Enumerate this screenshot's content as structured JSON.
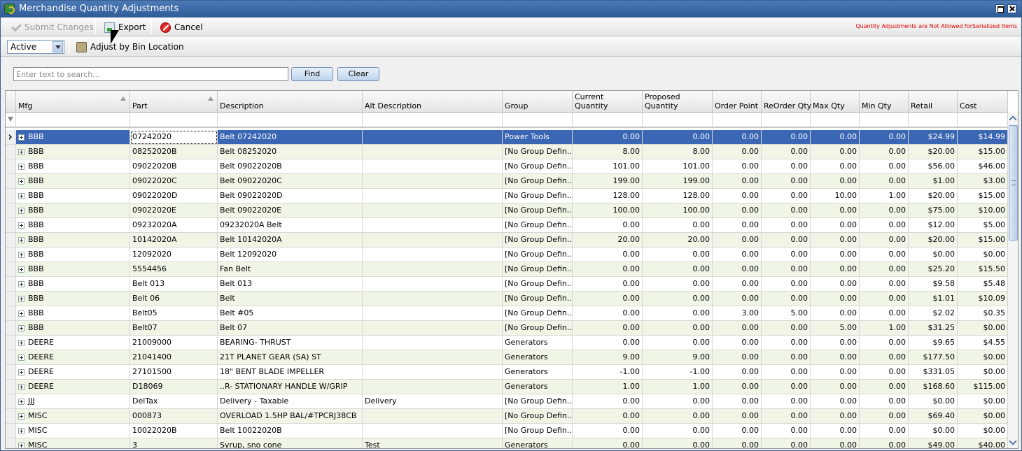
{
  "window": {
    "title": "Merchandise Quantity Adjustments"
  },
  "toolbar": {
    "submit_label": "Submit Changes",
    "export_label": "Export",
    "cancel_label": "Cancel",
    "warning": "Quantity Adjustments are Not Allowed forSerialized Items"
  },
  "filterbar": {
    "status_value": "Active",
    "adjust_bin_label": "Adjust by Bin Location"
  },
  "search": {
    "placeholder": "Enter text to search...",
    "find_label": "Find",
    "clear_label": "Clear"
  },
  "grid": {
    "headers": [
      "Mfg",
      "Part",
      "Description",
      "Alt Description",
      "Group",
      "Current\nQuantity",
      "Proposed\nQuantity",
      "Order Point",
      "ReOrder Qty",
      "Max Qty",
      "Min Qty",
      "Retail",
      "Cost"
    ],
    "rows": [
      [
        "BBB",
        "07242020",
        "Belt 07242020",
        "",
        "Power Tools",
        "0.00",
        "0.00",
        "0.00",
        "0.00",
        "0.00",
        "0.00",
        "$24.99",
        "$14.99"
      ],
      [
        "BBB",
        "08252020B",
        "Belt 08252020",
        "",
        "[No Group Defin...",
        "8.00",
        "8.00",
        "0.00",
        "0.00",
        "0.00",
        "0.00",
        "$20.00",
        "$15.00"
      ],
      [
        "BBB",
        "09022020B",
        "Belt 09022020B",
        "",
        "[No Group Defin...",
        "101.00",
        "101.00",
        "0.00",
        "0.00",
        "0.00",
        "0.00",
        "$56.00",
        "$46.00"
      ],
      [
        "BBB",
        "09022020C",
        "Belt 09022020C",
        "",
        "[No Group Defin...",
        "199.00",
        "199.00",
        "0.00",
        "0.00",
        "0.00",
        "0.00",
        "$1.00",
        "$3.00"
      ],
      [
        "BBB",
        "09022020D",
        "Belt 09022020D",
        "",
        "[No Group Defin...",
        "128.00",
        "128.00",
        "0.00",
        "0.00",
        "10.00",
        "1.00",
        "$20.00",
        "$15.00"
      ],
      [
        "BBB",
        "09022020E",
        "Belt 09022020E",
        "",
        "[No Group Defin...",
        "100.00",
        "100.00",
        "0.00",
        "0.00",
        "0.00",
        "0.00",
        "$75.00",
        "$10.00"
      ],
      [
        "BBB",
        "09232020A",
        "09232020A Belt",
        "",
        "[No Group Defin...",
        "0.00",
        "0.00",
        "0.00",
        "0.00",
        "0.00",
        "0.00",
        "$12.00",
        "$5.00"
      ],
      [
        "BBB",
        "10142020A",
        "Belt 10142020A",
        "",
        "[No Group Defin...",
        "20.00",
        "20.00",
        "0.00",
        "0.00",
        "0.00",
        "0.00",
        "$20.00",
        "$15.00"
      ],
      [
        "BBB",
        "12092020",
        "Belt 12092020",
        "",
        "[No Group Defin...",
        "0.00",
        "0.00",
        "0.00",
        "0.00",
        "0.00",
        "0.00",
        "$0.00",
        "$0.00"
      ],
      [
        "BBB",
        "5554456",
        "Fan Belt",
        "",
        "[No Group Defin...",
        "0.00",
        "0.00",
        "0.00",
        "0.00",
        "0.00",
        "0.00",
        "$25.20",
        "$15.50"
      ],
      [
        "BBB",
        "Belt 013",
        "Belt 013",
        "",
        "[No Group Defin...",
        "0.00",
        "0.00",
        "0.00",
        "0.00",
        "0.00",
        "0.00",
        "$9.58",
        "$5.48"
      ],
      [
        "BBB",
        "Belt 06",
        "Belt",
        "",
        "[No Group Defin...",
        "0.00",
        "0.00",
        "0.00",
        "0.00",
        "0.00",
        "0.00",
        "$1.01",
        "$10.09"
      ],
      [
        "BBB",
        "Belt05",
        "Belt #05",
        "",
        "[No Group Defin...",
        "0.00",
        "0.00",
        "3.00",
        "5.00",
        "0.00",
        "0.00",
        "$2.02",
        "$0.35"
      ],
      [
        "BBB",
        "Belt07",
        "Belt 07",
        "",
        "[No Group Defin...",
        "0.00",
        "0.00",
        "0.00",
        "0.00",
        "5.00",
        "1.00",
        "$31.25",
        "$0.00"
      ],
      [
        "DEERE",
        "21009000",
        "BEARING- THRUST",
        "",
        "Generators",
        "0.00",
        "0.00",
        "0.00",
        "0.00",
        "0.00",
        "0.00",
        "$9.65",
        "$4.55"
      ],
      [
        "DEERE",
        "21041400",
        "21T PLANET GEAR (SA) ST",
        "",
        "Generators",
        "9.00",
        "9.00",
        "0.00",
        "0.00",
        "0.00",
        "0.00",
        "$177.50",
        "$0.00"
      ],
      [
        "DEERE",
        "27101500",
        "18\" BENT BLADE IMPELLER",
        "",
        "Generators",
        "-1.00",
        "-1.00",
        "0.00",
        "0.00",
        "0.00",
        "0.00",
        "$331.05",
        "$0.00"
      ],
      [
        "DEERE",
        "D18069",
        "..R- STATIONARY HANDLE W/GRIP",
        "",
        "Generators",
        "1.00",
        "1.00",
        "0.00",
        "0.00",
        "0.00",
        "0.00",
        "$168.60",
        "$115.00"
      ],
      [
        "JJJ",
        "DelTax",
        "Delivery - Taxable",
        "Delivery",
        "[No Group Defin...",
        "0.00",
        "0.00",
        "0.00",
        "0.00",
        "0.00",
        "0.00",
        "$0.00",
        "$0.00"
      ],
      [
        "MISC",
        "000873",
        "OVERLOAD  1.5HP BAL/#TPCRJ38CB",
        "",
        "[No Group Defin...",
        "0.00",
        "0.00",
        "0.00",
        "0.00",
        "0.00",
        "0.00",
        "$69.40",
        "$0.00"
      ],
      [
        "MISC",
        "10022020B",
        "Belt 10022020B",
        "",
        "[No Group Defin...",
        "0.00",
        "0.00",
        "0.00",
        "0.00",
        "0.00",
        "0.00",
        "$0.00",
        "$0.00"
      ],
      [
        "MISC",
        "3",
        "Syrup, sno cone",
        "Test",
        "Generators",
        "0.00",
        "0.00",
        "0.00",
        "0.00",
        "0.00",
        "0.00",
        "$49.00",
        "$40.00"
      ]
    ]
  }
}
